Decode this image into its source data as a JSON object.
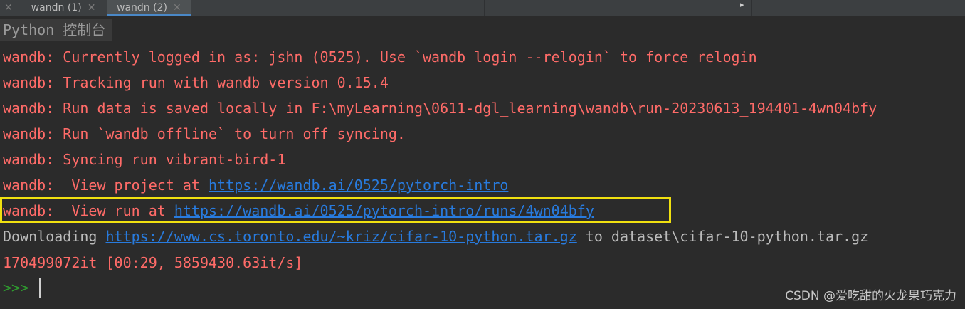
{
  "tabs": [
    {
      "label": "wandn (1)"
    },
    {
      "label": "wandn (2)",
      "active": true
    }
  ],
  "console_title": "Python 控制台",
  "lines": [
    {
      "prefix": "wandb: ",
      "text": "Currently logged in as: jshn (0525). Use `wandb login --relogin` to force relogin"
    },
    {
      "prefix": "wandb: ",
      "text": "Tracking run with wandb version 0.15.4"
    },
    {
      "prefix": "wandb: ",
      "text": "Run data is saved locally in F:\\myLearning\\0611-dgl_learning\\wandb\\run-20230613_194401-4wn04bfy"
    },
    {
      "prefix": "wandb: ",
      "text": "Run `wandb offline` to turn off syncing."
    },
    {
      "prefix": "wandb: ",
      "text": "Syncing run vibrant-bird-1"
    },
    {
      "prefix": "wandb: ",
      "text": " View project at ",
      "link": "https://wandb.ai/0525/pytorch-intro"
    },
    {
      "prefix": "wandb: ",
      "text": " View run at ",
      "link": "https://wandb.ai/0525/pytorch-intro/runs/4wn04bfy"
    }
  ],
  "download": {
    "prefix": "Downloading ",
    "link": "https://www.cs.toronto.edu/~kriz/cifar-10-python.tar.gz",
    "suffix": " to dataset\\cifar-10-python.tar.gz"
  },
  "progress": "170499072it [00:29, 5859430.63it/s]",
  "prompt": ">>>",
  "watermark": "CSDN @爱吃甜的火龙果巧克力",
  "colors": {
    "error": "#ff6b68",
    "link": "#287bde",
    "highlight": "#f0e010",
    "background": "#2b2b2b"
  }
}
